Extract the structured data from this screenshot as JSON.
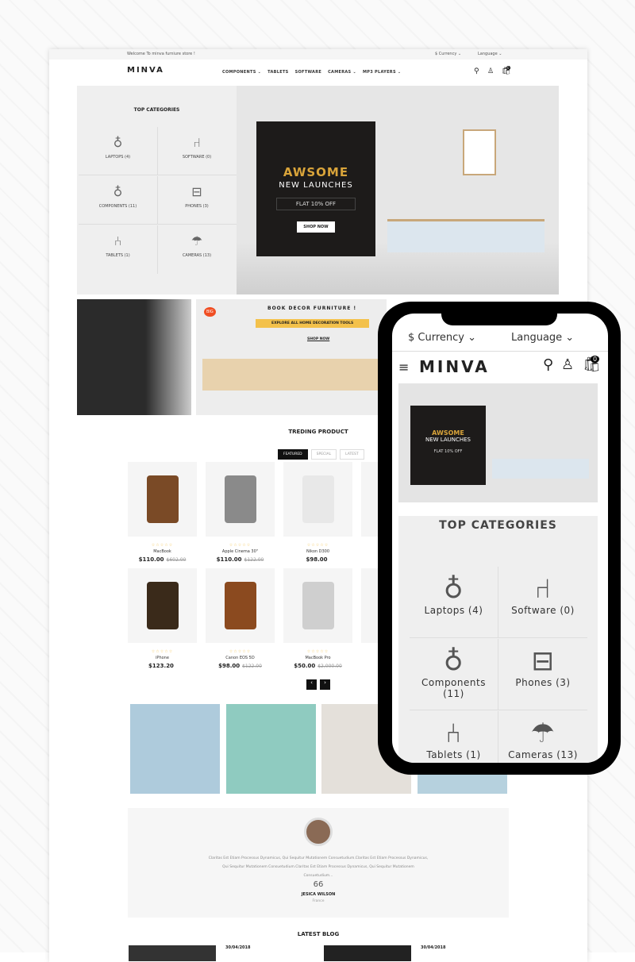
{
  "topbar": {
    "welcome": "Welcome To minva furniure store !",
    "currency": "$ Currency ⌄",
    "language": "Language ⌄"
  },
  "header": {
    "logo": "MINVA",
    "nav": [
      "COMPONENTS ⌄",
      "TABLETS",
      "SOFTWARE",
      "CAMERAS ⌄",
      "MP3 PLAYERS ⌄"
    ],
    "cart_count": "0"
  },
  "categories": {
    "title": "TOP CATEGORIES",
    "items": [
      {
        "label": "LAPTOPS (4)",
        "icon": "pendant-lamp-icon"
      },
      {
        "label": "SOFTWARE (0)",
        "icon": "desk-chair-icon"
      },
      {
        "label": "COMPONENTS (11)",
        "icon": "pendant-lamp-icon"
      },
      {
        "label": "PHONES (3)",
        "icon": "drawer-lamp-icon"
      },
      {
        "label": "TABLETS (1)",
        "icon": "armchair-lamp-icon"
      },
      {
        "label": "CAMERAS (13)",
        "icon": "patio-umbrella-icon"
      }
    ]
  },
  "hero": {
    "headline": "AWSOME",
    "sub": "NEW LAUNCHES",
    "offer": "FLAT 10% OFF",
    "cta": "SHOP NOW"
  },
  "promo": {
    "badge": "BIG",
    "title": "BOOK DECOR FURNITURE !",
    "tagline": "EXPLORE ALL HOME DECORATION TOOLS",
    "cta": "SHOP NOW"
  },
  "trending": {
    "title": "TREDING PRODUCT",
    "tabs": [
      "FEATURED",
      "SPECIAL",
      "LATEST"
    ],
    "products": [
      {
        "name": "MacBook",
        "price": "$110.00",
        "old": "$602.00"
      },
      {
        "name": "Apple Cinema 30\"",
        "price": "$110.00",
        "old": "$122.00"
      },
      {
        "name": "Nikon D300",
        "price": "$98.00",
        "old": ""
      },
      {
        "name": "iPhone",
        "price": "$123.20",
        "old": ""
      },
      {
        "name": "Canon EOS 5D",
        "price": "$98.00",
        "old": "$122.00"
      },
      {
        "name": "MacBook Pro",
        "price": "$50.00",
        "old": "$2,000.00"
      }
    ]
  },
  "testimonial": {
    "text": "Claritas Est Etiam Processus Dynamicus, Qui Sequitur Mutationem Consuetudium.Claritas Est Etiam Processus Dynamicus, Qui Sequitur Mutationem Consuetudium.Claritas Est Etiam Processus Dynamicus, Qui Sequitur Mutationem Consuetudium...",
    "quote": "66",
    "name": "JESICA WILSON",
    "location": "France"
  },
  "blog": {
    "title": "LATEST BLOG",
    "dates": [
      "30/04/2018",
      "30/04/2018"
    ]
  },
  "mobile": {
    "currency": "$ Currency ⌄",
    "language": "Language ⌄",
    "logo": "MINVA",
    "cart_count": "0",
    "hero_headline": "AWSOME",
    "hero_sub": "NEW LAUNCHES",
    "hero_offer": "FLAT 10% OFF",
    "categories_title": "TOP CATEGORIES",
    "categories": [
      "Laptops (4)",
      "Software (0)",
      "Components (11)",
      "Phones (3)",
      "Tablets (1)",
      "Cameras (13)"
    ]
  },
  "colors": {
    "accent": "#f3c14b",
    "dark": "#111111",
    "promo_badge": "#f04e23"
  }
}
